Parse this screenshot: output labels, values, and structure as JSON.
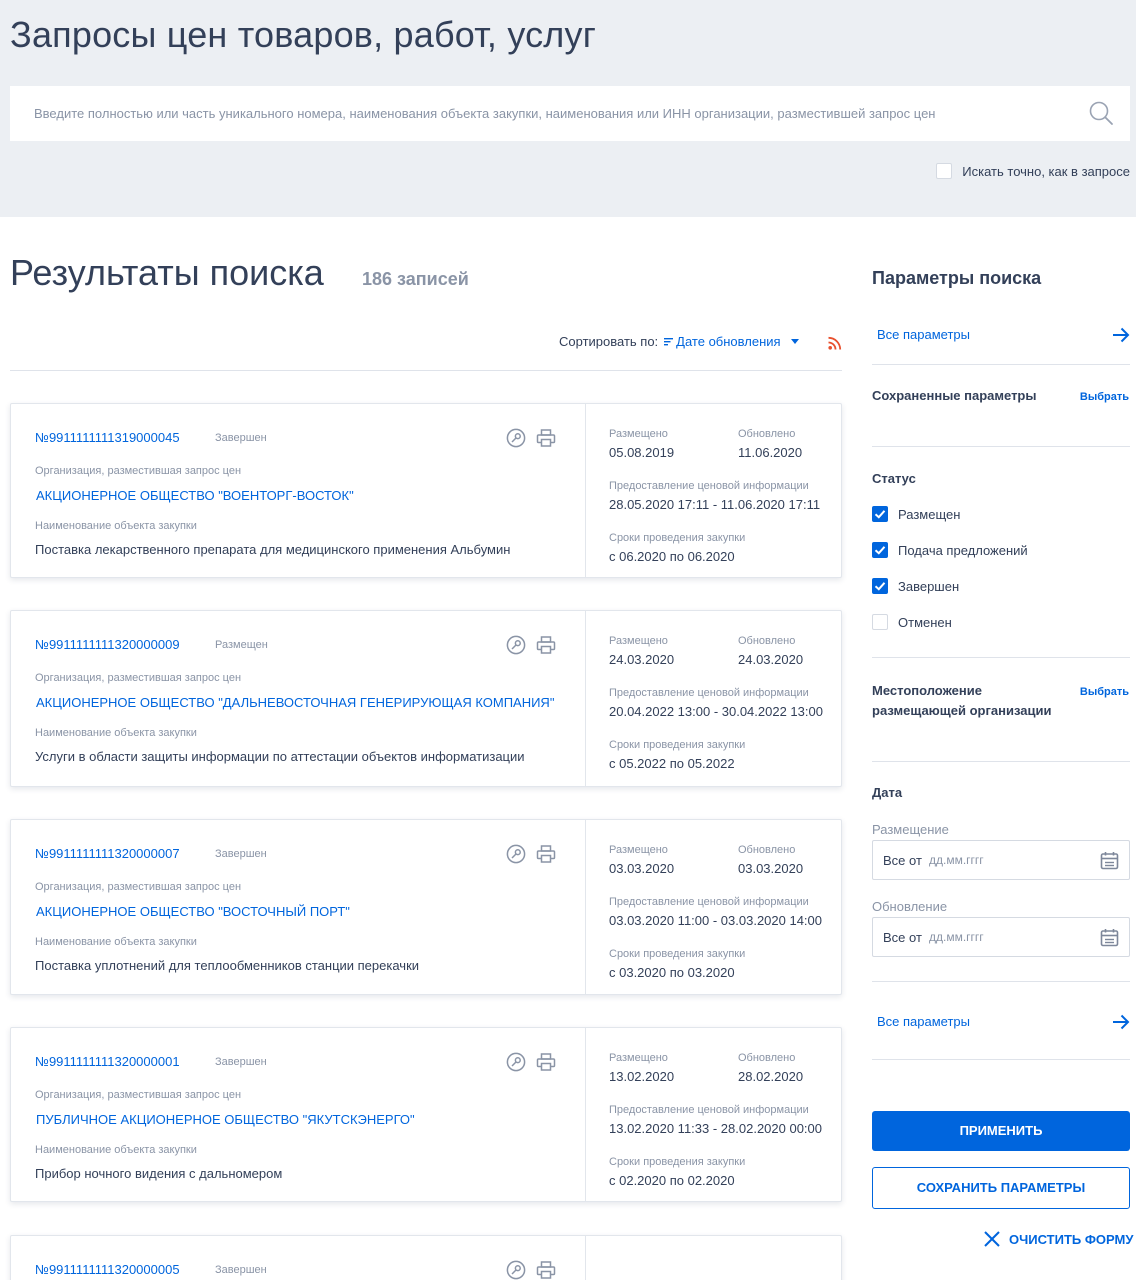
{
  "header": {
    "title": "Запросы цен товаров, работ, услуг",
    "search_placeholder": "Введите полностью или часть уникального номера, наименования объекта закупки, наименования или ИНН организации, разместившей запрос цен",
    "exact_label": "Искать точно, как в запросе"
  },
  "results": {
    "title": "Результаты поиска",
    "count": "186 записей",
    "sort_label": "Сортировать по:",
    "sort_value": "Дате обновления"
  },
  "card_labels": {
    "org": "Организация, разместившая запрос цен",
    "object": "Наименование объекта закупки",
    "placed": "Размещено",
    "updated": "Обновлено",
    "price_info": "Предоставление ценовой информации",
    "terms": "Сроки проведения закупки"
  },
  "cards": [
    {
      "number": "№9911111111319000045",
      "status": "Завершен",
      "org": "АКЦИОНЕРНОЕ ОБЩЕСТВО \"ВОЕНТОРГ-ВОСТОК\"",
      "object": "Поставка лекарственного препарата для медицинского применения Альбумин",
      "placed": "05.08.2019",
      "updated": "11.06.2020",
      "price_info": "28.05.2020 17:11 - 11.06.2020 17:11",
      "terms": "с 06.2020  по 06.2020"
    },
    {
      "number": "№9911111111320000009",
      "status": "Размещен",
      "org": "АКЦИОНЕРНОЕ ОБЩЕСТВО \"ДАЛЬНЕВОСТОЧНАЯ ГЕНЕРИРУЮЩАЯ КОМПАНИЯ\"",
      "object": "Услуги в области защиты информации по аттестации объектов информатизации",
      "placed": "24.03.2020",
      "updated": "24.03.2020",
      "price_info": "20.04.2022 13:00 - 30.04.2022 13:00",
      "terms": "с 05.2022  по 05.2022"
    },
    {
      "number": "№9911111111320000007",
      "status": "Завершен",
      "org": "АКЦИОНЕРНОЕ ОБЩЕСТВО \"ВОСТОЧНЫЙ ПОРТ\"",
      "object": "Поставка уплотнений для теплообменников станции перекачки",
      "placed": "03.03.2020",
      "updated": "03.03.2020",
      "price_info": "03.03.2020 11:00 - 03.03.2020 14:00",
      "terms": "с 03.2020  по 03.2020"
    },
    {
      "number": "№9911111111320000001",
      "status": "Завершен",
      "org": "ПУБЛИЧНОЕ АКЦИОНЕРНОЕ ОБЩЕСТВО \"ЯКУТСКЭНЕРГО\"",
      "object": "Прибор ночного видения с дальномером",
      "placed": "13.02.2020",
      "updated": "28.02.2020",
      "price_info": "13.02.2020 11:33 - 28.02.2020 00:00",
      "terms": "с 02.2020  по 02.2020"
    },
    {
      "number": "№9911111111320000005",
      "status": "Завершен"
    }
  ],
  "sidebar": {
    "title": "Параметры поиска",
    "all_params": "Все параметры",
    "saved_params": "Сохраненные параметры",
    "choose": "Выбрать",
    "status_title": "Статус",
    "statuses": [
      {
        "label": "Размещен",
        "checked": true
      },
      {
        "label": "Подача предложений",
        "checked": true
      },
      {
        "label": "Завершен",
        "checked": true
      },
      {
        "label": "Отменен",
        "checked": false
      }
    ],
    "location_title": "Местоположение размещающей организации",
    "date_title": "Дата",
    "placement_label": "Размещение",
    "update_label": "Обновление",
    "date_prefix": "Все от",
    "date_placeholder": "дд.мм.гггг",
    "apply": "ПРИМЕНИТЬ",
    "save": "СОХРАНИТЬ ПАРАМЕТРЫ",
    "clear": "ОЧИСТИТЬ ФОРМУ"
  },
  "colors": {
    "accent": "#0065dd",
    "text": "#334059",
    "muted": "#8a94a6",
    "header_bg": "#eceff3",
    "rss": "#e8502e"
  }
}
